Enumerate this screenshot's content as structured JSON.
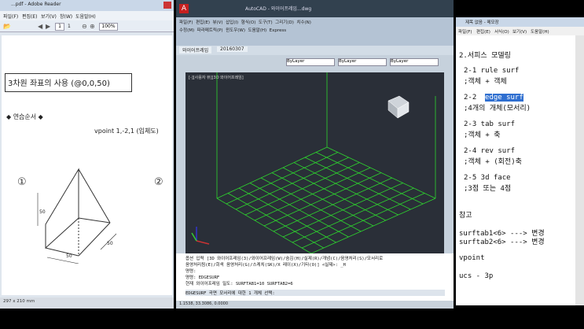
{
  "pdf": {
    "title": "...pdf - Adobe Reader",
    "menu": [
      "파일(F)",
      "편집(E)",
      "보기(V)",
      "창(W)",
      "도움말(H)"
    ],
    "page_num": "1",
    "page_total": "1",
    "zoom": "100%",
    "heading": "3차원 좌표의 사용 (@0,0,50)",
    "practice_label": "◆ 연습순서 ◆",
    "vpoint_note": "vpoint 1,-2,1 (입체도)",
    "marker1": "①",
    "marker2": "②",
    "dim_height": "50",
    "dim_left": "50",
    "dim_right": "50",
    "status_size": "297 x 210 mm"
  },
  "cad": {
    "title": "AutoCAD - 와이어프레임...dwg",
    "ribbon_menu": [
      "파일(F)",
      "편집(E)",
      "뷰(V)",
      "삽입(I)",
      "형식(O)",
      "도구(T)",
      "그리기(D)",
      "치수(N)",
      "수정(M)",
      "파라메트릭(P)",
      "윈도우(W)",
      "도움말(H)",
      "Express"
    ],
    "tabs": [
      "와이어프레임",
      "20160307"
    ],
    "layer": "ByLayer",
    "viewport_label": "[-][사용자 뷰][3D 와이어프레임]",
    "nav_cube": "RIGHT",
    "commands": [
      "옵션 입력 [3D 와이어프레임(3)/와이어프레임(W)/숨김(H)/실제(R)/개념(C)/음영처리(S)/모서리로",
      "음영처리됨(E)/회색 음영처리(G)/스케치(SK)/X 레이(X)/기타(O)] <실제>: _H",
      "명령:",
      "명령: EDGESURF",
      "현재 와이어프레임 밀도: SURFTAB1=10  SURFTAB2=6",
      "EDGESURF 곡면 모서리에 대한 1 개체 선택:"
    ],
    "status_coords": "1.1538, 33.3086, 0.0000"
  },
  "notepad": {
    "title": "제목 없음 - 메모장",
    "menu": [
      "파일(F)",
      "편집(E)",
      "서식(O)",
      "보기(V)",
      "도움말(H)"
    ],
    "lines": [
      "2.서피스 모델링",
      "2-1 rule surf",
      "    ;객체 + 객체",
      "2-2",
      "edge surf",
      "    ;4개의 개체(모서리)",
      "2-3 tab surf",
      "    ;객체 + 축",
      "2-4 rev surf",
      "    ;객체 + (회전)축",
      "2-5 3d face",
      "    ;3점 또는 4점",
      "참고",
      "  surftab1<6> ---> 변경",
      "  surftab2<6> ---> 변경",
      "vpoint",
      "ucs - 3p"
    ]
  },
  "colors": {
    "grid": "#2ed52e",
    "viewport_bg": "#2a2f38",
    "highlight": "#2f6fd0"
  }
}
